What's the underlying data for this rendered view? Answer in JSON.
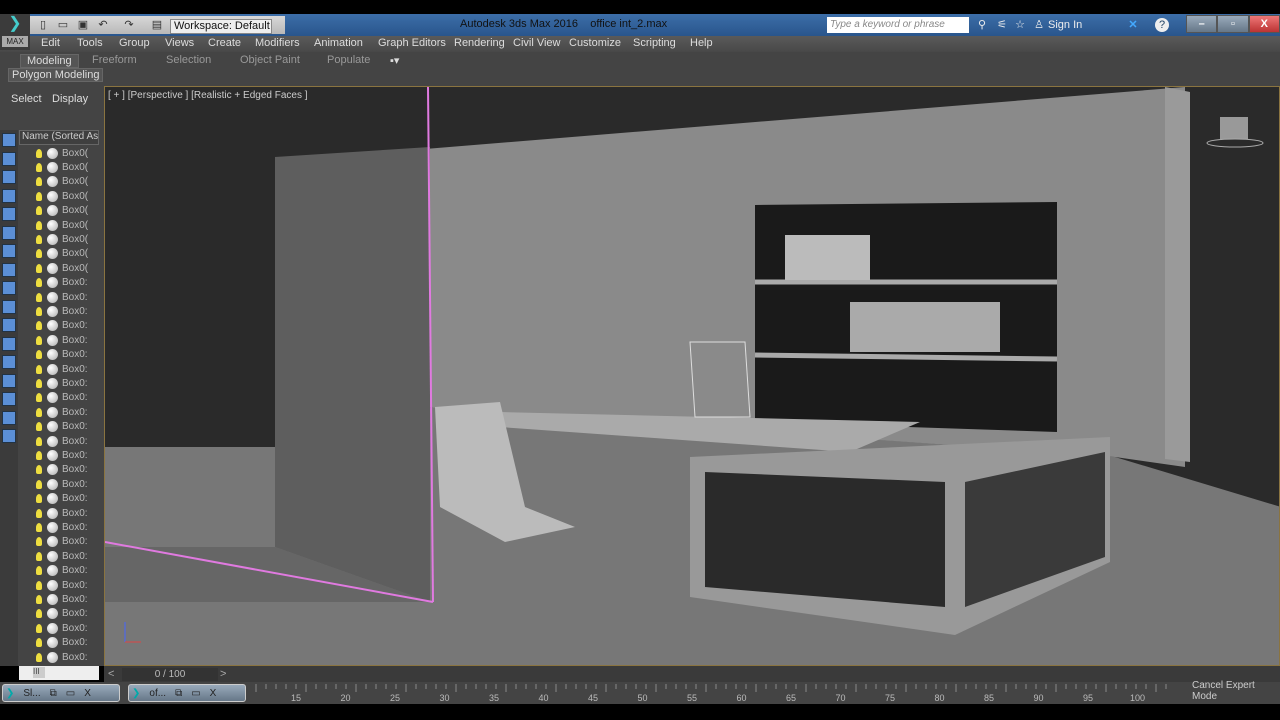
{
  "app": {
    "title": "Autodesk 3ds Max 2016",
    "file": "office int_2.max",
    "logo": "MAX"
  },
  "quick_access": {
    "workspace": "Workspace: Default"
  },
  "search": {
    "placeholder": "Type a keyword or phrase"
  },
  "account": {
    "sign_in": "Sign In"
  },
  "window_buttons": {
    "minimize": "–",
    "restore": "▫",
    "close": "X"
  },
  "menu": [
    "Edit",
    "Tools",
    "Group",
    "Views",
    "Create",
    "Modifiers",
    "Animation",
    "Graph Editors",
    "Rendering",
    "Civil View",
    "Customize",
    "Scripting",
    "Help"
  ],
  "ribbon": {
    "tabs": [
      "Modeling",
      "Freeform",
      "Selection",
      "Object Paint",
      "Populate"
    ],
    "panel": "Polygon Modeling"
  },
  "scene_explorer": {
    "tabs": [
      "Select",
      "Display"
    ],
    "column_header": "Name (Sorted Ascer",
    "items": [
      "Box0(",
      "Box0(",
      "Box0(",
      "Box0(",
      "Box0(",
      "Box0(",
      "Box0(",
      "Box0(",
      "Box0(",
      "Box0:",
      "Box0:",
      "Box0:",
      "Box0:",
      "Box0:",
      "Box0:",
      "Box0:",
      "Box0:",
      "Box0:",
      "Box0:",
      "Box0:",
      "Box0:",
      "Box0:",
      "Box0:",
      "Box0:",
      "Box0:",
      "Box0:",
      "Box0:",
      "Box0:",
      "Box0:",
      "Box0:",
      "Box0:",
      "Box0:",
      "Box0:",
      "Box0:",
      "Box0:",
      "Box0:"
    ]
  },
  "viewport": {
    "label": "[ + ] [Perspective ] [Realistic + Edged Faces ]"
  },
  "timeline": {
    "frame": "0 / 100",
    "prev": "<",
    "next": ">",
    "ticks": [
      "15",
      "20",
      "25",
      "30",
      "35",
      "40",
      "45",
      "50",
      "55",
      "60",
      "65",
      "70",
      "75",
      "80",
      "85",
      "90",
      "95",
      "100"
    ]
  },
  "taskbar": [
    {
      "label": "Sl..."
    },
    {
      "label": "of..."
    }
  ],
  "status": {
    "expert_mode": "Cancel Expert Mode"
  }
}
